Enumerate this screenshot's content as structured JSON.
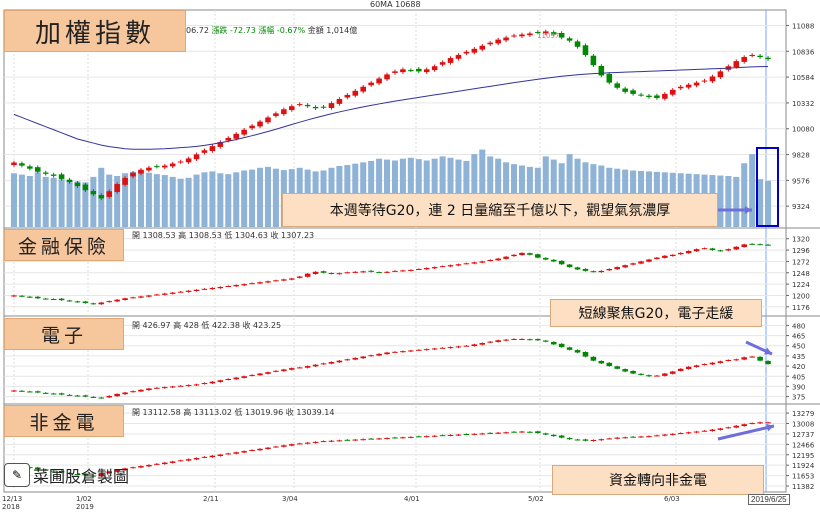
{
  "legend_top": "60MA 10688",
  "panels": [
    {
      "id": "taiex",
      "title": "加權指數",
      "header": {
        "close": "06.72",
        "change_label": "漲跌",
        "change": "-72.73",
        "pct_label": "漲幅",
        "pct": "-0.67%",
        "amount_label": "金額",
        "amount": "1,014億"
      },
      "peak_label": "11097",
      "note": "本週等待G20，連 2 日量縮至千億以下，觀望氣氛濃厚"
    },
    {
      "id": "finance",
      "title": "金融保險",
      "header": "開 1308.53 高 1308.53 低 1304.63 收 1307.23",
      "note": "短線聚焦G20，電子走緩"
    },
    {
      "id": "electronics",
      "title": "電子",
      "header": "開 426.97 高 428 低 422.38 收 423.25"
    },
    {
      "id": "non_financial_electronics",
      "title": "非金電",
      "header": "開 13112.58 高 13113.02 低 13019.96 收 13039.14",
      "note": "資金轉向非金電"
    }
  ],
  "watermark": "菜圃股倉製圖",
  "date_badge": "2019/6/25",
  "colors": {
    "up": "#dd1111",
    "down": "#008800",
    "volume": "#8fb3d6",
    "ma": "#333399",
    "title_bg": "#f6c79d",
    "note_bg": "#fde0c4",
    "arrow": "#6f6fdc",
    "highlight_box": "#0000cc"
  },
  "chart_data": [
    {
      "type": "candlestick",
      "panel": "taiex",
      "x_ticks": [
        "12/13\n2018",
        "1/02\n2019",
        "2/11",
        "3/04",
        "4/01",
        "5/02",
        "6/03"
      ],
      "y_ticks": [
        11088,
        10836,
        10584,
        10332,
        10080,
        9828,
        9576,
        9324
      ],
      "ylim": [
        9150,
        11200
      ],
      "close": [
        9750,
        9720,
        9690,
        9660,
        9640,
        9620,
        9590,
        9560,
        9520,
        9480,
        9440,
        9400,
        9470,
        9540,
        9600,
        9650,
        9680,
        9700,
        9710,
        9720,
        9740,
        9760,
        9790,
        9830,
        9870,
        9910,
        9950,
        9990,
        10030,
        10070,
        10110,
        10150,
        10190,
        10230,
        10270,
        10300,
        10320,
        10300,
        10280,
        10290,
        10330,
        10370,
        10410,
        10450,
        10490,
        10530,
        10570,
        10610,
        10640,
        10660,
        10650,
        10640,
        10660,
        10690,
        10730,
        10770,
        10800,
        10830,
        10860,
        10890,
        10920,
        10950,
        10970,
        10990,
        11000,
        11010,
        11020,
        11030,
        11000,
        10970,
        10940,
        10880,
        10800,
        10700,
        10600,
        10530,
        10480,
        10440,
        10420,
        10410,
        10390,
        10380,
        10420,
        10460,
        10490,
        10510,
        10530,
        10550,
        10590,
        10640,
        10690,
        10740,
        10780,
        10800,
        10780,
        10760
      ],
      "ma60": [
        10220,
        10190,
        10160,
        10130,
        10100,
        10070,
        10040,
        10010,
        9980,
        9960,
        9940,
        9920,
        9905,
        9895,
        9885,
        9880,
        9880,
        9880,
        9882,
        9885,
        9890,
        9895,
        9900,
        9908,
        9918,
        9930,
        9943,
        9958,
        9975,
        9993,
        10012,
        10032,
        10053,
        10075,
        10098,
        10121,
        10144,
        10166,
        10187,
        10207,
        10226,
        10244,
        10261,
        10277,
        10293,
        10308,
        10322,
        10336,
        10349,
        10362,
        10374,
        10386,
        10398,
        10410,
        10422,
        10434,
        10446,
        10458,
        10470,
        10482,
        10494,
        10506,
        10518,
        10530,
        10541,
        10552,
        10563,
        10573,
        10583,
        10592,
        10600,
        10607,
        10613,
        10618,
        10622,
        10626,
        10629,
        10632,
        10635,
        10638,
        10641,
        10644,
        10647,
        10650,
        10653,
        10656,
        10659,
        10662,
        10665,
        10668,
        10672,
        10676,
        10680,
        10684,
        10686,
        10688
      ],
      "volume": [
        1180,
        1150,
        1120,
        1200,
        1100,
        1080,
        1050,
        1020,
        1000,
        980,
        1100,
        1300,
        1150,
        1120,
        1180,
        1210,
        1230,
        1190,
        1160,
        1140,
        1100,
        1060,
        1080,
        1150,
        1200,
        1220,
        1180,
        1160,
        1200,
        1240,
        1260,
        1300,
        1320,
        1280,
        1250,
        1270,
        1300,
        1260,
        1220,
        1240,
        1300,
        1340,
        1360,
        1390,
        1420,
        1450,
        1500,
        1480,
        1460,
        1500,
        1520,
        1490,
        1460,
        1500,
        1550,
        1520,
        1480,
        1450,
        1600,
        1700,
        1550,
        1500,
        1420,
        1380,
        1350,
        1320,
        1300,
        1550,
        1480,
        1400,
        1600,
        1500,
        1420,
        1380,
        1350,
        1300,
        1280,
        1260,
        1240,
        1230,
        1220,
        1210,
        1200,
        1190,
        1180,
        1170,
        1160,
        1150,
        1140,
        1130,
        1120,
        1100,
        1400,
        1600,
        1050,
        1014
      ],
      "volume_max": 1800
    },
    {
      "type": "candlestick",
      "panel": "finance",
      "y_ticks": [
        1320,
        1296,
        1272,
        1248,
        1224,
        1200,
        1176
      ],
      "ylim": [
        1165,
        1330
      ],
      "close": [
        1200,
        1198,
        1196,
        1194,
        1193,
        1192,
        1190,
        1188,
        1186,
        1184,
        1182,
        1185,
        1188,
        1191,
        1194,
        1196,
        1198,
        1200,
        1202,
        1204,
        1206,
        1208,
        1210,
        1212,
        1214,
        1216,
        1218,
        1220,
        1222,
        1224,
        1226,
        1228,
        1230,
        1232,
        1234,
        1236,
        1240,
        1246,
        1250,
        1248,
        1246,
        1247,
        1249,
        1250,
        1251,
        1250,
        1249,
        1250,
        1252,
        1253,
        1254,
        1256,
        1258,
        1260,
        1262,
        1264,
        1266,
        1268,
        1270,
        1272,
        1275,
        1278,
        1282,
        1286,
        1290,
        1286,
        1280,
        1276,
        1272,
        1266,
        1260,
        1255,
        1252,
        1250,
        1252,
        1256,
        1260,
        1264,
        1268,
        1272,
        1276,
        1280,
        1284,
        1286,
        1290,
        1294,
        1298,
        1300,
        1296,
        1294,
        1298,
        1303,
        1308,
        1309,
        1308,
        1307
      ],
      "x_count": 96
    },
    {
      "type": "candlestick",
      "panel": "electronics",
      "y_ticks": [
        480,
        465,
        450,
        435,
        420,
        405,
        390,
        375
      ],
      "ylim": [
        370,
        485
      ],
      "close": [
        384,
        383,
        382,
        381,
        380,
        379,
        378,
        377,
        376,
        375,
        374,
        373,
        376,
        379,
        381,
        383,
        385,
        387,
        388,
        389,
        390,
        391,
        392,
        393,
        395,
        397,
        399,
        401,
        403,
        405,
        407,
        409,
        411,
        413,
        415,
        417,
        418,
        420,
        422,
        424,
        426,
        428,
        430,
        432,
        434,
        436,
        438,
        440,
        441,
        442,
        443,
        444,
        445,
        446,
        447,
        448,
        449,
        450,
        452,
        454,
        456,
        458,
        459,
        460,
        460,
        459,
        458,
        456,
        452,
        448,
        444,
        440,
        434,
        428,
        424,
        420,
        416,
        412,
        409,
        407,
        405,
        406,
        409,
        412,
        416,
        419,
        421,
        423,
        425,
        427,
        429,
        430,
        433,
        434,
        428,
        423
      ],
      "x_count": 96
    },
    {
      "type": "candlestick",
      "panel": "non_financial_electronics",
      "y_ticks": [
        13279,
        13008,
        12737,
        12466,
        12195,
        11924,
        11653,
        11382
      ],
      "ylim": [
        11330,
        13360
      ],
      "close": [
        11900,
        11880,
        11850,
        11820,
        11790,
        11760,
        11730,
        11700,
        11680,
        11660,
        11640,
        11700,
        11760,
        11800,
        11840,
        11870,
        11900,
        11930,
        11960,
        11990,
        12020,
        12050,
        12080,
        12110,
        12140,
        12170,
        12200,
        12230,
        12260,
        12290,
        12320,
        12350,
        12380,
        12410,
        12440,
        12470,
        12490,
        12510,
        12530,
        12550,
        12560,
        12570,
        12580,
        12590,
        12600,
        12610,
        12620,
        12630,
        12640,
        12650,
        12660,
        12670,
        12680,
        12690,
        12700,
        12710,
        12720,
        12730,
        12740,
        12750,
        12760,
        12770,
        12780,
        12790,
        12800,
        12790,
        12760,
        12720,
        12680,
        12640,
        12600,
        12580,
        12560,
        12580,
        12600,
        12620,
        12640,
        12650,
        12660,
        12670,
        12680,
        12700,
        12720,
        12740,
        12760,
        12780,
        12800,
        12820,
        12850,
        12880,
        12910,
        12950,
        12990,
        13020,
        13040,
        13039
      ],
      "x_count": 96
    }
  ]
}
